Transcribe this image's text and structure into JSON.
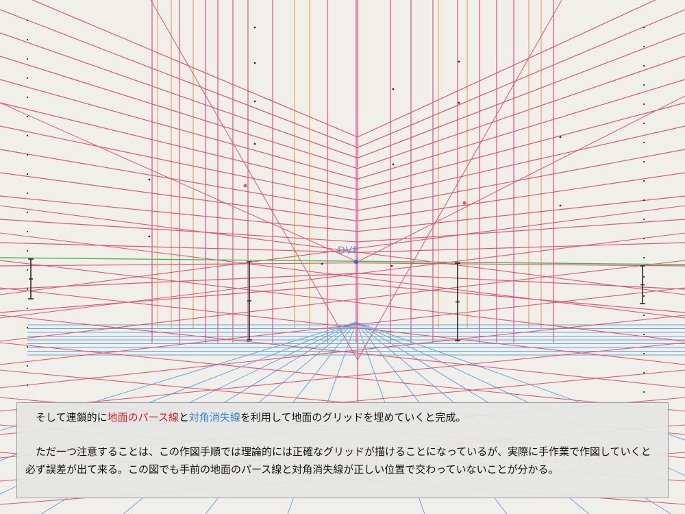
{
  "diagram": {
    "dvp_label": "DVP",
    "colors": {
      "paper": "#f1efea",
      "red_lines": "#e2556e",
      "pink_lines": "#e34c8e",
      "orange_lines": "#eba35a",
      "horizon": "#4cb64c",
      "blue_grid": "#5aa7e8",
      "tick_marks": "#2b2b2b",
      "dvp_dot": "#2f6fd0"
    }
  },
  "caption": {
    "p1_a": "そして連鎖的に",
    "p1_red": "地面のパース線",
    "p1_b": "と",
    "p1_blue": "対角消失線",
    "p1_c": "を利用して地面のグリッドを埋めていくと完成。",
    "p2": "ただ一つ注意することは、この作図手順では理論的には正確なグリッドが描けることになっているが、実際に手作業で作図していくと必ず誤差が出て来る。この図でも手前の地面のパース線と対角消失線が正しい位置で交わっていないことが分かる。"
  }
}
